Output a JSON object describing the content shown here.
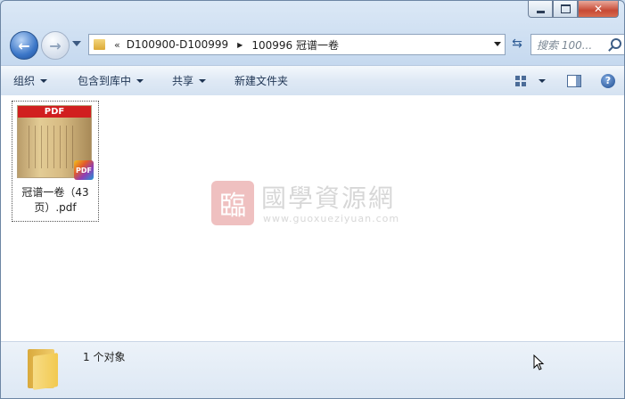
{
  "address": {
    "crumbs": [
      "D100900-D100999",
      "100996 冠谱一卷"
    ],
    "overflow_glyph": "«"
  },
  "search": {
    "placeholder": "搜索 100..."
  },
  "toolbar": {
    "organize": "组织",
    "include_in_library": "包含到库中",
    "share": "共享",
    "new_folder": "新建文件夹"
  },
  "file": {
    "name_line1": "冠谱一卷（43",
    "name_line2": "页）.pdf",
    "thumb_banner": "PDF",
    "badge": "PDF"
  },
  "watermark": {
    "seal": "臨",
    "title": "國學資源網",
    "url": "www.guoxueziyuan.com"
  },
  "status": {
    "count_text": "1 个对象"
  },
  "help_glyph": "?",
  "colors": {
    "accent": "#3c77c8",
    "close": "#c74a35",
    "pdf_red": "#d11f1f"
  }
}
